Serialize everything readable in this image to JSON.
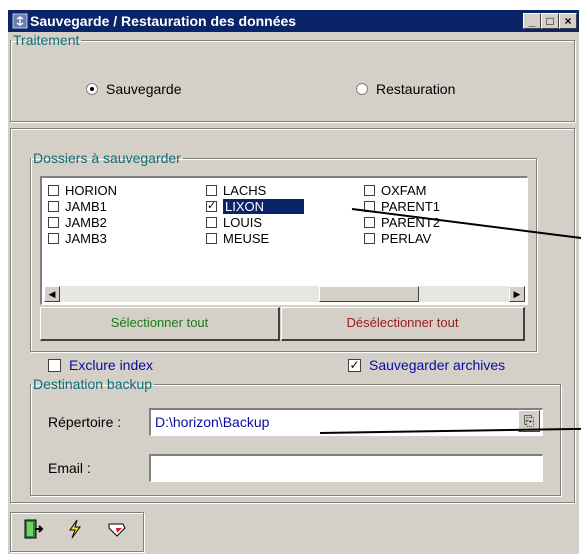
{
  "window": {
    "title": "Sauvegarde / Restauration des données",
    "controls": [
      "_",
      "□",
      "×"
    ]
  },
  "traitement": {
    "legend": "Traitement",
    "options": [
      {
        "label": "Sauvegarde",
        "selected": true
      },
      {
        "label": "Restauration",
        "selected": false
      }
    ]
  },
  "dossiers": {
    "legend": "Dossiers à sauvegarder",
    "folders": [
      {
        "label": "HORION",
        "checked": false
      },
      {
        "label": "JAMB1",
        "checked": false
      },
      {
        "label": "JAMB2",
        "checked": false
      },
      {
        "label": "JAMB3",
        "checked": false
      },
      {
        "label": "LACHS",
        "checked": false
      },
      {
        "label": "LIXON",
        "checked": true,
        "selected": true
      },
      {
        "label": "LOUIS",
        "checked": false
      },
      {
        "label": "MEUSE",
        "checked": false
      },
      {
        "label": "OXFAM",
        "checked": false
      },
      {
        "label": "PARENT1",
        "checked": false
      },
      {
        "label": "PARENT2",
        "checked": false
      },
      {
        "label": "PERLAV",
        "checked": false
      }
    ],
    "select_all": "Sélectionner tout",
    "deselect_all": "Désélectionner tout"
  },
  "options": {
    "exclure_index": {
      "label": "Exclure index",
      "checked": false
    },
    "sauvegarder_archives": {
      "label": "Sauvegarder archives",
      "checked": true
    }
  },
  "destination": {
    "legend": "Destination backup",
    "repertoire_label": "Répertoire :",
    "repertoire_value": "D:\\horizon\\Backup",
    "email_label": "Email :",
    "email_value": ""
  },
  "colors": {
    "title_bar": "#0a246a",
    "select_all": "#1a7a1a",
    "deselect_all": "#9a1a1a",
    "legend": "#0a6e7a",
    "option_text": "#0a0aa0"
  },
  "toolbar": {
    "icons": [
      "exit-door-icon",
      "lightning-icon",
      "eraser-icon"
    ]
  }
}
